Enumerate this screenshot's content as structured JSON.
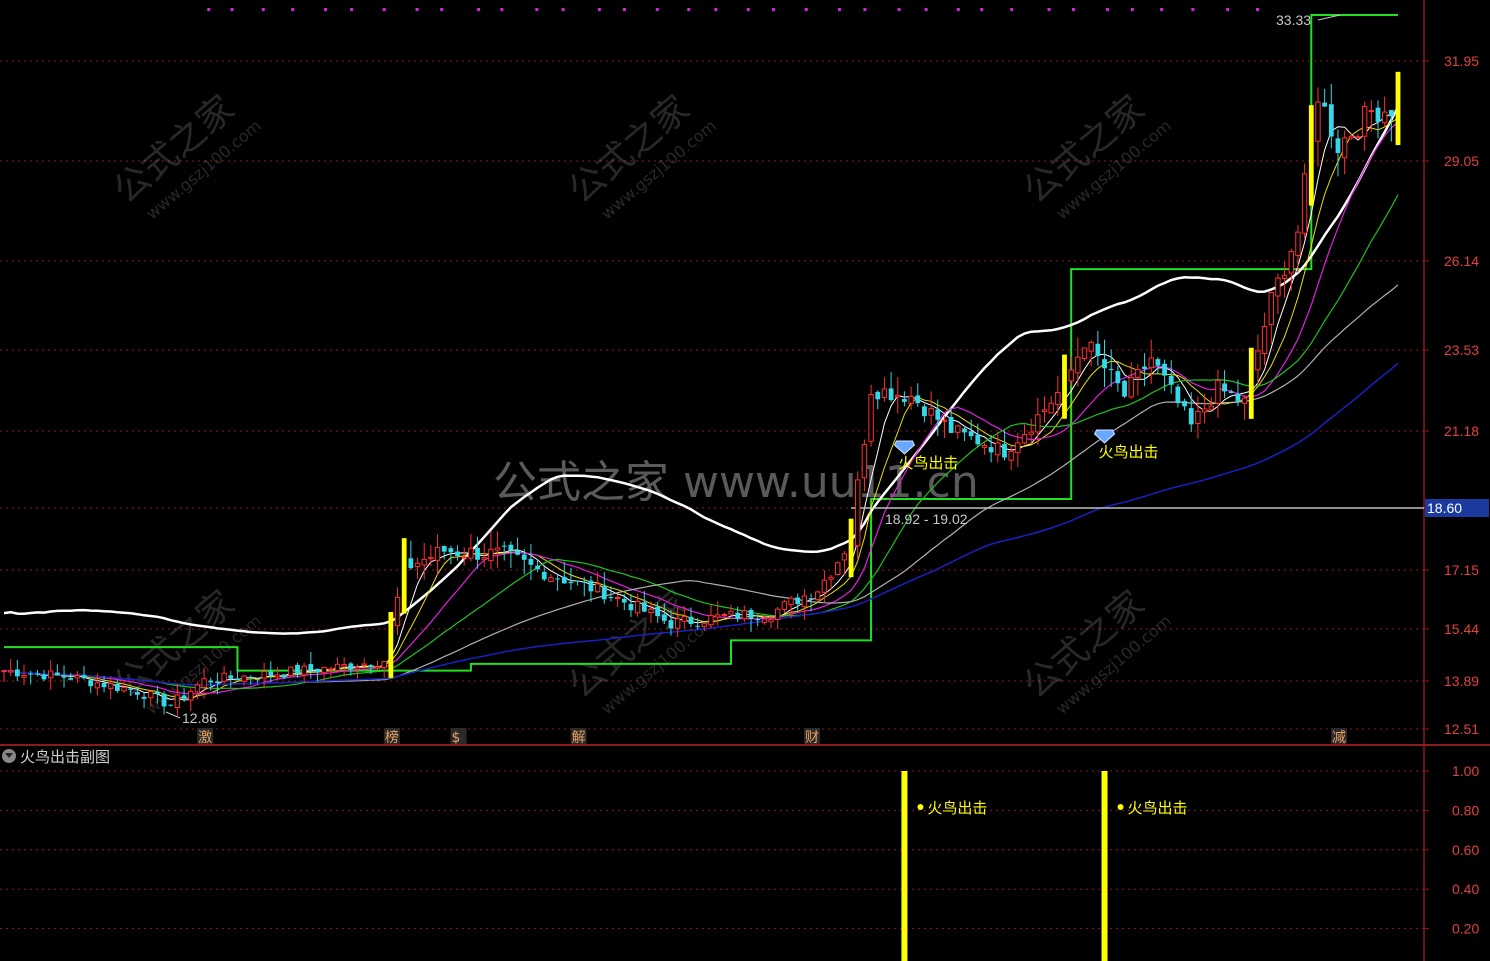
{
  "watermarks": {
    "cn": "公式之家",
    "url": "www.gszj100.com",
    "center": "公式之家 www.uu11.cn"
  },
  "subchart": {
    "title": "火鸟出击副图",
    "signal_label": "火鸟出击"
  },
  "colors": {
    "background": "#000000",
    "grid": "#8b1a1a",
    "axis_text": "#e04040",
    "up_candle": "#ff3030",
    "down_candle": "#35d8e8",
    "yellow_bar": "#ffff00",
    "ma_short": "#ffffff",
    "ma_yellow": "#e8e000",
    "ma_magenta": "#e020e0",
    "ma_green": "#20c020",
    "ma_gray": "#b0b0b0",
    "ma_blue": "#1a20c0",
    "upper_band": "#ffffff",
    "box_line": "#20e020",
    "hline": "#c0c0c0",
    "hline_tag_bg": "#1a3aa0",
    "signal": "#ffff00",
    "dot_row": "#e020e0"
  },
  "chart_data": [
    {
      "type": "candlestick",
      "title": "",
      "y_axis_ticks": [
        31.95,
        29.05,
        26.14,
        23.53,
        21.18,
        18.6,
        17.15,
        15.44,
        13.89,
        12.51
      ],
      "ylim": [
        12.0,
        34.0
      ],
      "n_bars": 210,
      "annotations": {
        "high_label": "33.33",
        "low_label": "12.86",
        "range_label": "18.92 - 19.02",
        "hline_value": "18.60",
        "signals": [
          {
            "label": "火鸟出击",
            "bar": 135
          },
          {
            "label": "火鸟出击",
            "bar": 165
          }
        ]
      },
      "event_tags": [
        {
          "label": "激",
          "bar": 30
        },
        {
          "label": "榜",
          "bar": 58
        },
        {
          "label": "$",
          "bar": 68
        },
        {
          "label": "解",
          "bar": 86
        },
        {
          "label": "财",
          "bar": 121
        },
        {
          "label": "减",
          "bar": 200
        }
      ],
      "anchors": [
        [
          0,
          14.2
        ],
        [
          10,
          14.0
        ],
        [
          20,
          13.6
        ],
        [
          25,
          13.2
        ],
        [
          30,
          13.9
        ],
        [
          40,
          14.1
        ],
        [
          50,
          14.3
        ],
        [
          57,
          14.5
        ],
        [
          60,
          17.2
        ],
        [
          66,
          17.6
        ],
        [
          75,
          17.5
        ],
        [
          82,
          17.0
        ],
        [
          90,
          16.5
        ],
        [
          100,
          15.6
        ],
        [
          108,
          15.8
        ],
        [
          115,
          15.9
        ],
        [
          122,
          16.6
        ],
        [
          127,
          17.9
        ],
        [
          130,
          22.4
        ],
        [
          136,
          22.2
        ],
        [
          142,
          21.2
        ],
        [
          150,
          20.5
        ],
        [
          155,
          21.6
        ],
        [
          159,
          22.5
        ],
        [
          162,
          23.8
        ],
        [
          168,
          22.2
        ],
        [
          172,
          23.3
        ],
        [
          178,
          21.3
        ],
        [
          182,
          22.4
        ],
        [
          186,
          22.0
        ],
        [
          190,
          25.0
        ],
        [
          194,
          27.0
        ],
        [
          197,
          31.0
        ],
        [
          200,
          29.5
        ],
        [
          205,
          30.5
        ],
        [
          209,
          30.6
        ]
      ]
    },
    {
      "type": "bar",
      "title": "",
      "y_axis_ticks": [
        1.0,
        0.8,
        0.6,
        0.4,
        0.2
      ],
      "ylim": [
        0,
        1.05
      ],
      "signal_bars": [
        {
          "bar": 135,
          "value": 1.0,
          "label": "火鸟出击"
        },
        {
          "bar": 165,
          "value": 1.0,
          "label": "火鸟出击"
        }
      ]
    }
  ]
}
